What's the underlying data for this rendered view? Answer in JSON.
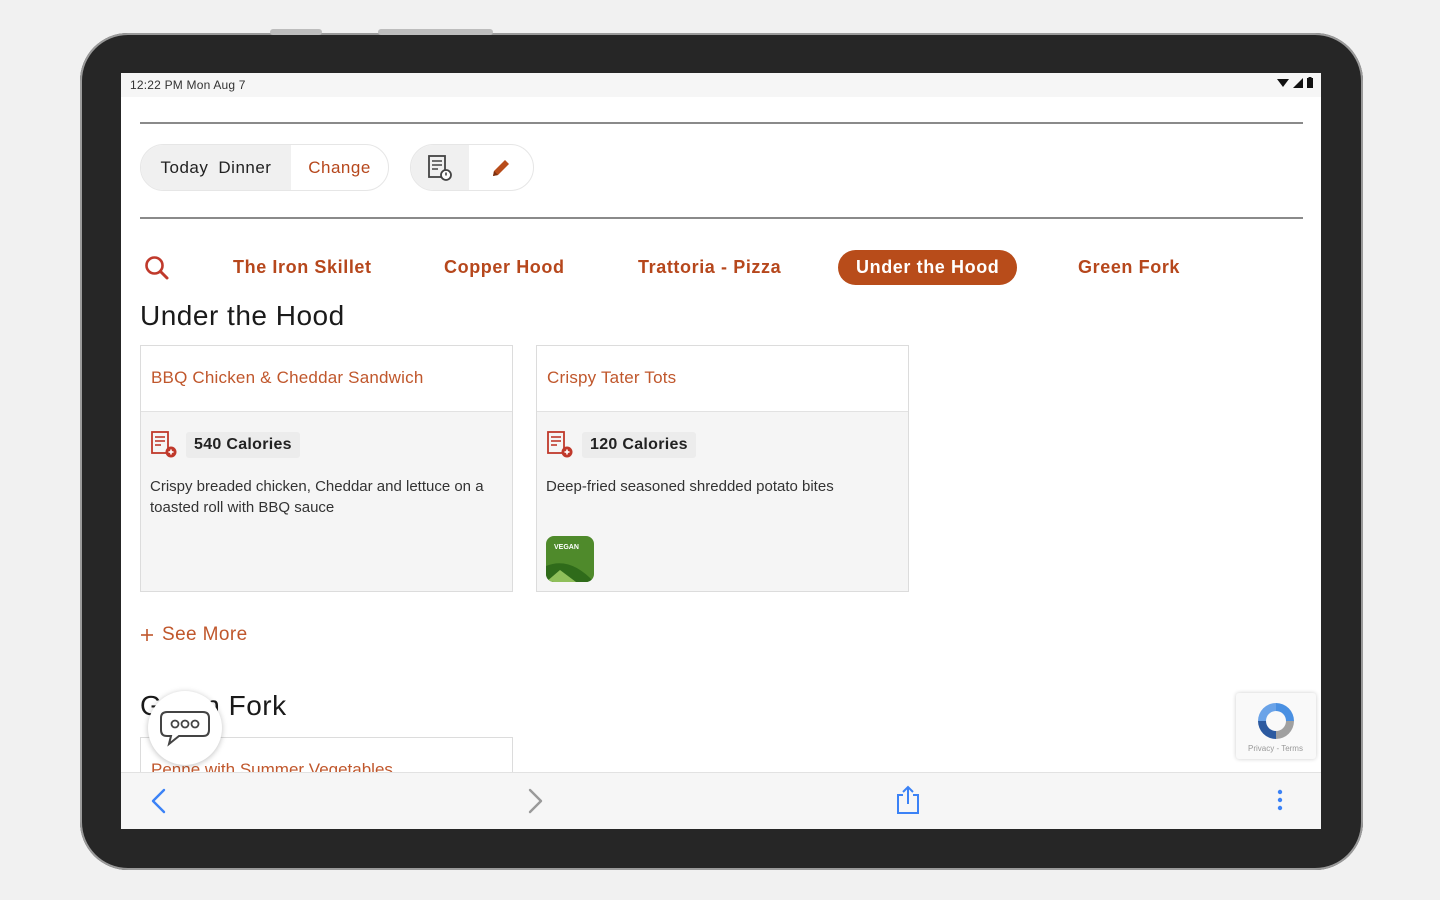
{
  "statusbar": {
    "time_date": "12:22 PM   Mon Aug 7"
  },
  "meal_selector": {
    "day": "Today",
    "meal": "Dinner",
    "change_label": "Change"
  },
  "nav": {
    "items": [
      "The Iron Skillet",
      "Copper Hood",
      "Trattoria - Pizza",
      "Under the Hood",
      "Green Fork"
    ],
    "active_index": 3
  },
  "sections": [
    {
      "title": "Under the Hood",
      "cards": [
        {
          "name": "BBQ Chicken & Cheddar Sandwich",
          "calories": "540 Calories",
          "description": "Crispy breaded chicken, Cheddar and lettuce on a toasted roll with BBQ sauce"
        },
        {
          "name": "Crispy Tater Tots",
          "calories": "120 Calories",
          "description": "Deep-fried seasoned shredded potato bites",
          "badge": "VEGAN"
        }
      ],
      "see_more": "See More"
    },
    {
      "title": "Green Fork",
      "cards": [
        {
          "name": "Penne with Summer Vegetables"
        }
      ]
    }
  ],
  "recaptcha": {
    "terms": "Privacy - Terms"
  },
  "colors": {
    "accent": "#b84c1a",
    "link": "#c0572c",
    "ios_blue": "#3b82f6",
    "vegan_green": "#4f8a2b"
  },
  "icons": [
    "search-icon",
    "nutrition-icon",
    "pencil-icon",
    "chat-icon",
    "back-icon",
    "forward-icon",
    "share-icon",
    "more-icon",
    "recaptcha-icon"
  ]
}
